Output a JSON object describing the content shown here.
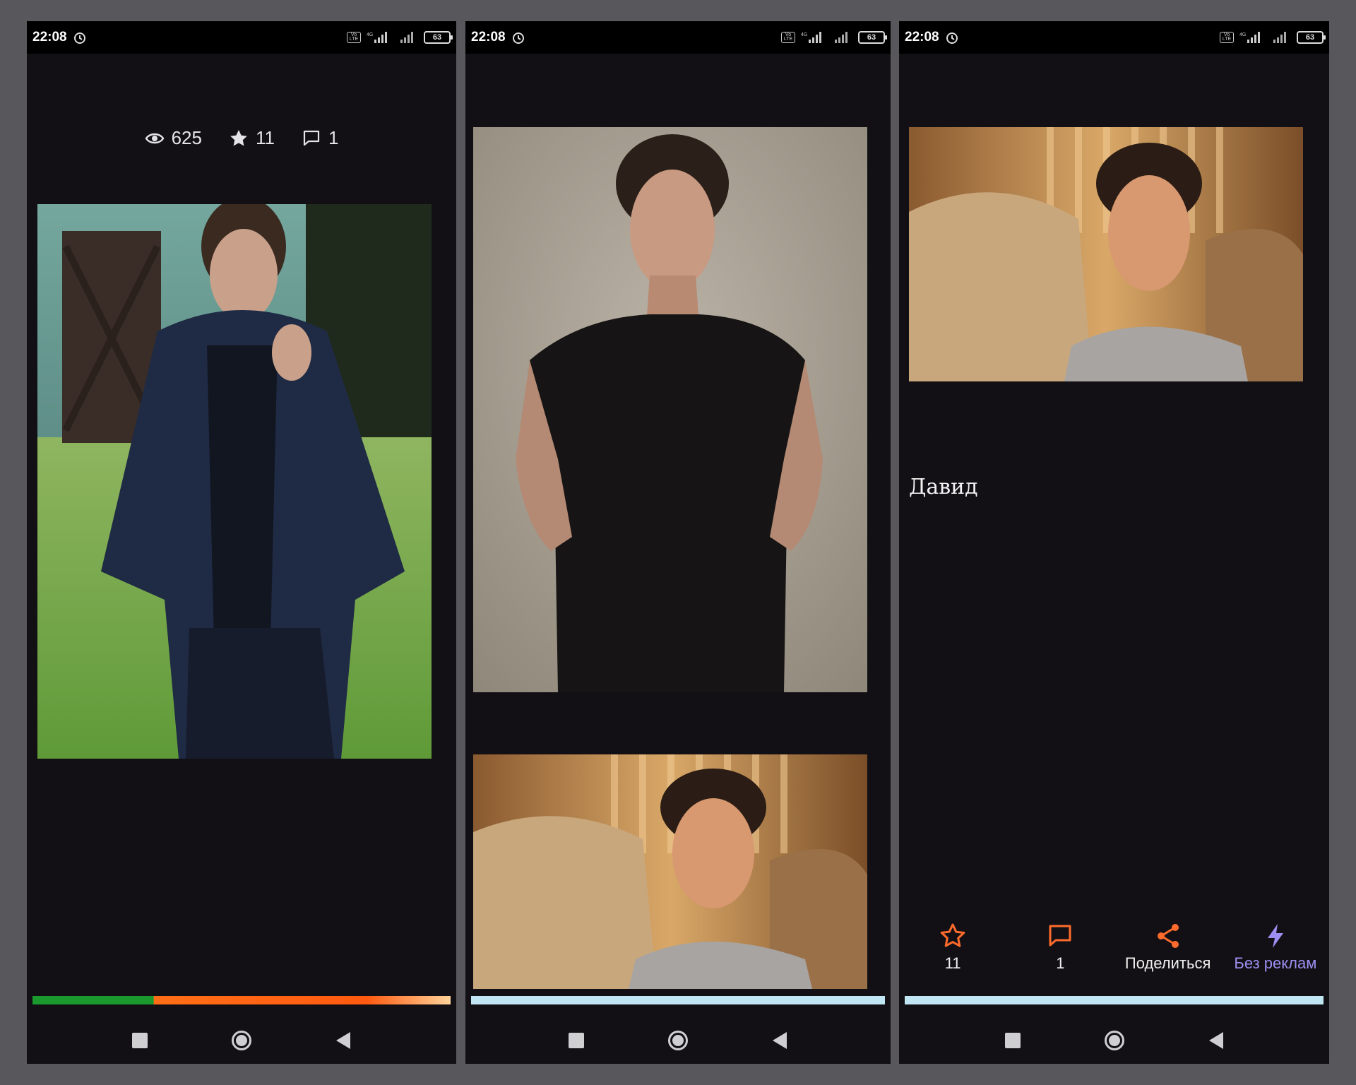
{
  "colors": {
    "accent": "#ff6b2c",
    "purple": "#9d8ff0",
    "background": "#121014"
  },
  "statusbar": {
    "time": "22:08",
    "volte": "Vo LTE",
    "network": "4G",
    "battery": "63"
  },
  "screen1": {
    "stats": {
      "views": "625",
      "favorites": "11",
      "comments": "1"
    },
    "progress": {
      "green_fraction": 0.29
    }
  },
  "screen3": {
    "post_title": "Давид",
    "actions": [
      {
        "icon": "star-icon",
        "label": "11"
      },
      {
        "icon": "comment-icon",
        "label": "1"
      },
      {
        "icon": "share-icon",
        "label": "Поделиться"
      },
      {
        "icon": "lightning-icon",
        "label": "Без реклам"
      }
    ]
  },
  "navbar": {
    "icons": [
      "recents-icon",
      "home-icon",
      "back-icon"
    ]
  }
}
